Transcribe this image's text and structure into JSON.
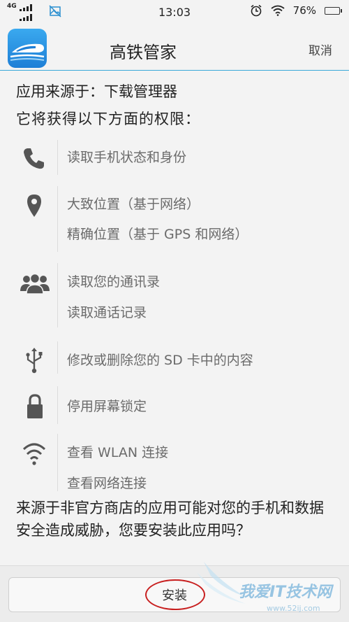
{
  "status_bar": {
    "network": "4G",
    "time": "13:03",
    "battery_percent": "76%",
    "battery_level": 0.76,
    "icons": [
      "signal-icon",
      "image-icon",
      "alarm-icon",
      "wifi-icon",
      "battery-icon"
    ]
  },
  "header": {
    "app_name": "高铁管家",
    "cancel_label": "取消"
  },
  "source_line": "应用来源于：下载管理器",
  "permission_heading": "它将获得以下方面的权限：",
  "permissions": [
    {
      "icon": "phone-icon",
      "items": [
        "读取手机状态和身份"
      ]
    },
    {
      "icon": "location-icon",
      "items": [
        "大致位置（基于网络）",
        "精确位置（基于 GPS 和网络）"
      ]
    },
    {
      "icon": "contacts-icon",
      "items": [
        "读取您的通讯录",
        "读取通话记录"
      ]
    },
    {
      "icon": "usb-icon",
      "items": [
        "修改或删除您的 SD 卡中的内容"
      ]
    },
    {
      "icon": "lock-icon",
      "items": [
        "停用屏幕锁定"
      ]
    },
    {
      "icon": "wifi-icon",
      "items": [
        "查看 WLAN 连接",
        "查看网络连接"
      ]
    }
  ],
  "warning": "来源于非官方商店的应用可能对您的手机和数据安全造成威胁，您要安装此应用吗？",
  "install_label": "安装",
  "watermark": {
    "text": "我爱IT技术网",
    "url": "www.52ij.com"
  },
  "colors": {
    "divider": "#39a9d8",
    "app_icon": "#1e7fd6",
    "highlight_circle": "#c82020",
    "battery": "#2fbf2f"
  }
}
